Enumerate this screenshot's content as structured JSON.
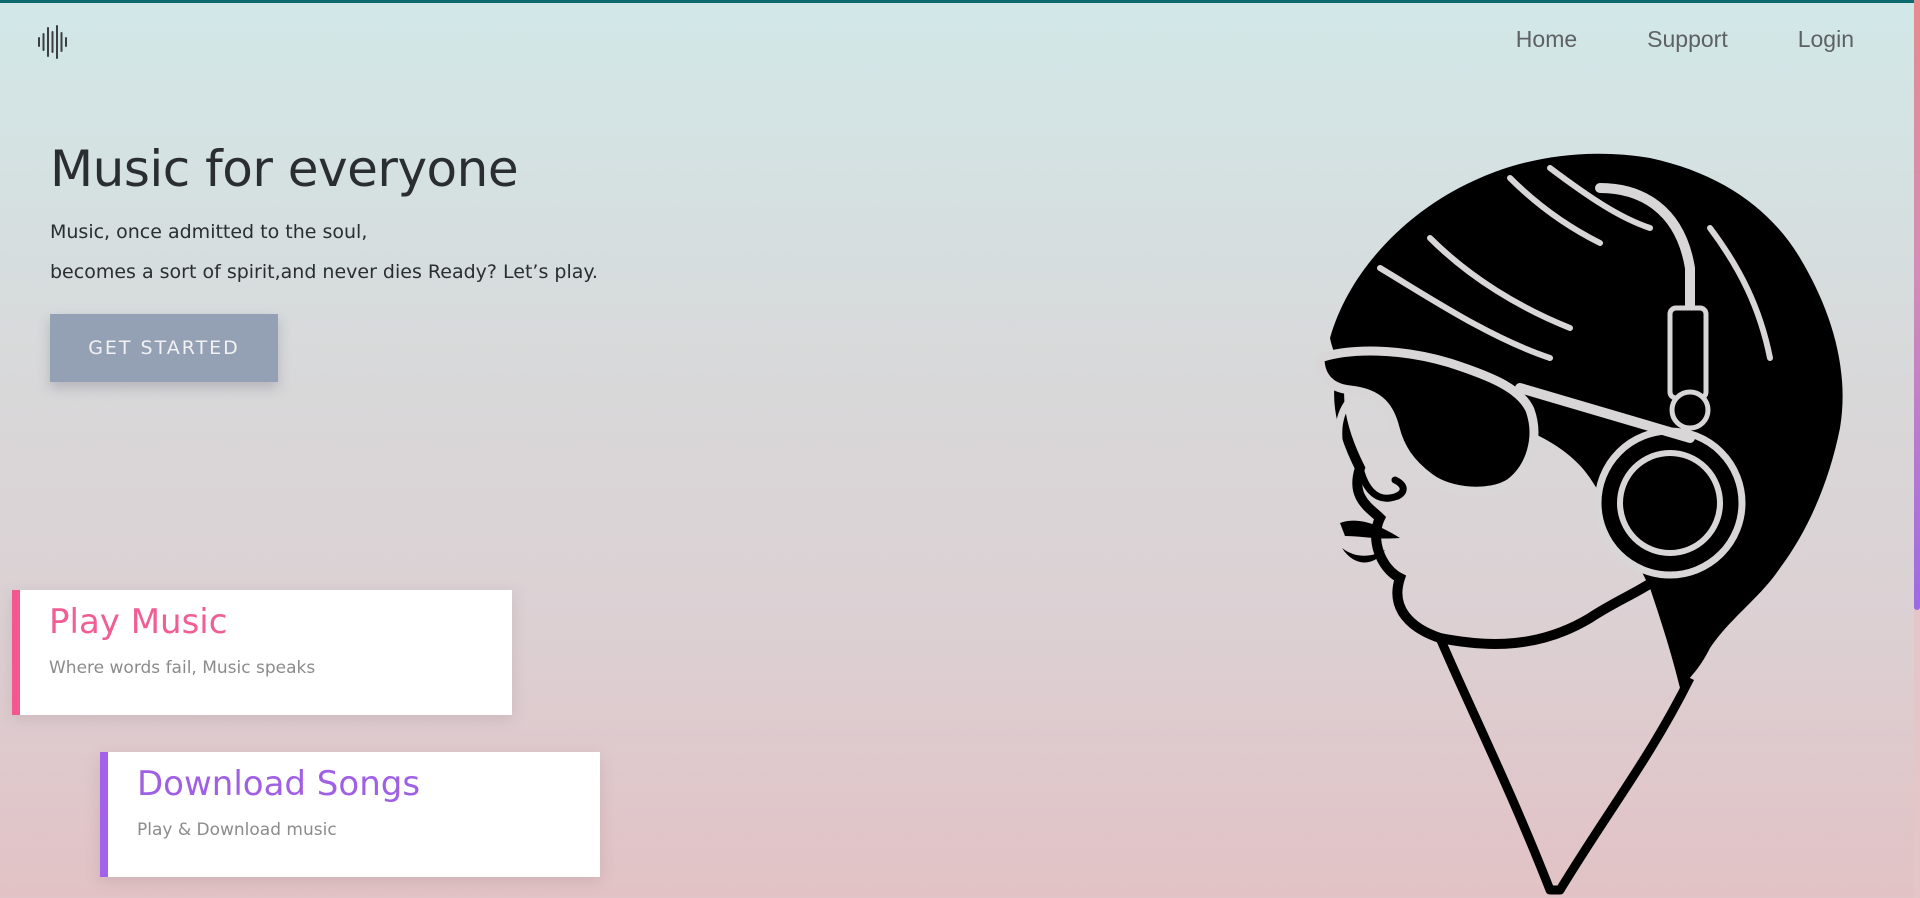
{
  "nav": {
    "links": [
      "Home",
      "Support",
      "Login"
    ]
  },
  "hero": {
    "title": "Music for everyone",
    "line1": "Music, once admitted to the soul,",
    "line2": "becomes a sort of spirit,and never dies Ready? Let’s play.",
    "cta_label": "GET STARTED"
  },
  "cards": [
    {
      "title": "Play Music",
      "subtitle": "Where words fail, Music speaks",
      "accent": "#f2578f"
    },
    {
      "title": "Download Songs",
      "subtitle": "Play & Download music",
      "accent": "#a462ec"
    }
  ],
  "icons": {
    "logo": "sound-wave-icon",
    "illustration": "person-with-headphones-illustration"
  },
  "colors": {
    "text_dark": "#2a2d31",
    "nav_text": "#5d6166",
    "cta_bg": "#94a0b3",
    "top_border": "#0e6a6e"
  }
}
